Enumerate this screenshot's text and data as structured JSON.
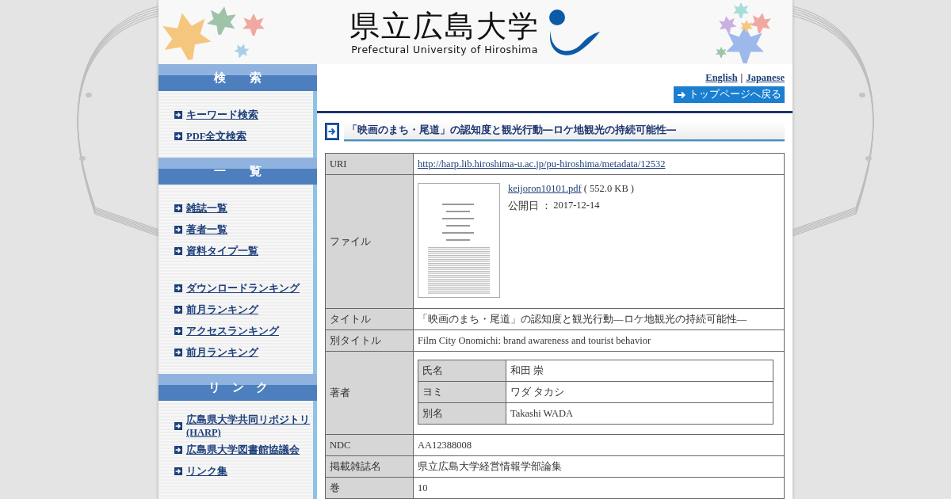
{
  "header": {
    "logo_title": "県立広島大学",
    "logo_subtitle": "Prefectural University of Hiroshima"
  },
  "sidebar": [
    {
      "title": "検　　索",
      "groups": [
        [
          "キーワード検索",
          "PDF全文検索"
        ]
      ]
    },
    {
      "title": "一　　覧",
      "groups": [
        [
          "雑誌一覧",
          "著者一覧",
          "資料タイプ一覧"
        ],
        [
          "ダウンロードランキング",
          "前月ランキング",
          "アクセスランキング",
          "前月ランキング"
        ]
      ]
    },
    {
      "title": "リ　ン　ク",
      "groups": [
        [
          "広島県大学共同リポジトリ (HARP)",
          "広島県大学図書館協議会",
          "リンク集"
        ]
      ]
    }
  ],
  "languages": [
    "English",
    "Japanese"
  ],
  "language_separator": "|",
  "back_button": "トップページへ戻る",
  "page_title": "「映画のまち・尾道」の認知度と観光行動―ロケ地観光の持続可能性―",
  "table": [
    {
      "kind": "link",
      "label": "URI",
      "value": "http://harp.lib.hiroshima-u.ac.jp/pu-hiroshima/metadata/12532"
    },
    {
      "kind": "file",
      "label": "ファイル",
      "file_name": "keijoron10101.pdf",
      "size": "( 552.0 KB )",
      "date_label": "公開日 ：",
      "date": "2017-12-14"
    },
    {
      "kind": "text",
      "label": "タイトル",
      "value": "「映画のまち・尾道」の認知度と観光行動―ロケ地観光の持続可能性―"
    },
    {
      "kind": "text",
      "label": "別タイトル",
      "value": "Film City Onomichi: brand awareness and tourist behavior"
    },
    {
      "kind": "authors",
      "label": "著者",
      "rows": [
        {
          "label": "氏名",
          "value": "和田 崇"
        },
        {
          "label": "ヨミ",
          "value": "ワダ タカシ"
        },
        {
          "label": "別名",
          "value": "Takashi WADA"
        }
      ]
    },
    {
      "kind": "text",
      "label": "NDC",
      "value": "AA12388008"
    },
    {
      "kind": "text",
      "label": "掲載雑誌名",
      "value": "県立広島大学経営情報学部論集"
    },
    {
      "kind": "text",
      "label": "巻",
      "value": "10"
    }
  ]
}
